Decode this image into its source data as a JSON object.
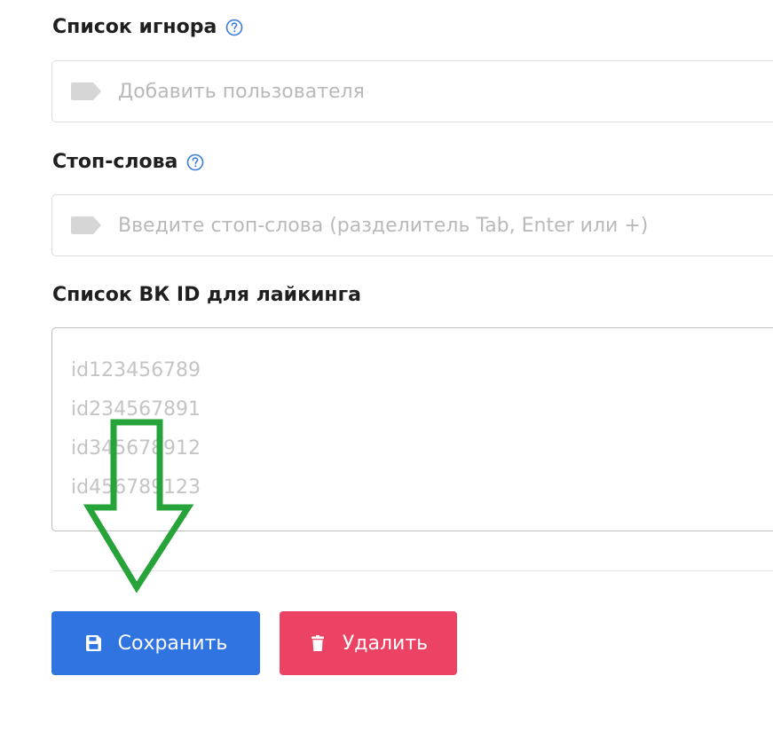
{
  "ignore_list": {
    "label": "Список игнора",
    "placeholder": "Добавить пользователя",
    "icons": {
      "help": "question-circle-icon",
      "tag": "tag-icon"
    }
  },
  "stop_words": {
    "label": "Стоп-слова",
    "placeholder": "Введите стоп-слова (разделитель Tab, Enter или +)",
    "icons": {
      "help": "question-circle-icon",
      "tag": "tag-icon"
    }
  },
  "vk_ids": {
    "label": "Список ВК ID для лайкинга",
    "placeholder": "id123456789\nid234567891\nid345678912\nid456789123"
  },
  "actions": {
    "save_label": "Сохранить",
    "delete_label": "Удалить",
    "icons": {
      "save": "floppy-disk-icon",
      "delete": "trash-icon"
    }
  },
  "annotation": {
    "icon": "arrow-down-icon"
  },
  "colors": {
    "primary": "#2f74e0",
    "danger": "#ec4365",
    "annotation_arrow": "#27a439",
    "help_icon": "#3b7ddd"
  }
}
